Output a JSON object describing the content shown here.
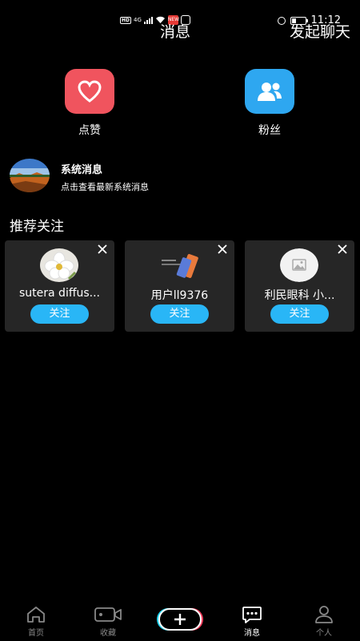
{
  "status_bar": {
    "hd": "HD",
    "network": "4G",
    "app_badge": "NEW",
    "time": "11:12",
    "battery_level": 0.3
  },
  "header": {
    "title": "消息",
    "action": "发起聊天"
  },
  "entries": {
    "likes": {
      "label": "点赞",
      "icon": "heart-icon",
      "color": "#f0545e"
    },
    "fans": {
      "label": "粉丝",
      "icon": "users-icon",
      "color": "#2ea7f0"
    }
  },
  "system_message": {
    "title": "系统消息",
    "desc": "点击查看最新系统消息"
  },
  "recommend": {
    "title": "推荐关注",
    "cards": [
      {
        "name": "sutera diffus...",
        "follow": "关注"
      },
      {
        "name": "用户ll9376",
        "follow": "关注"
      },
      {
        "name": "利民眼科  小...",
        "follow": "关注"
      }
    ]
  },
  "nav": {
    "home": "首页",
    "favorites": "收藏",
    "messages": "消息",
    "me": "个人"
  },
  "colors": {
    "accent": "#29b6f6",
    "card_bg": "#262626"
  }
}
